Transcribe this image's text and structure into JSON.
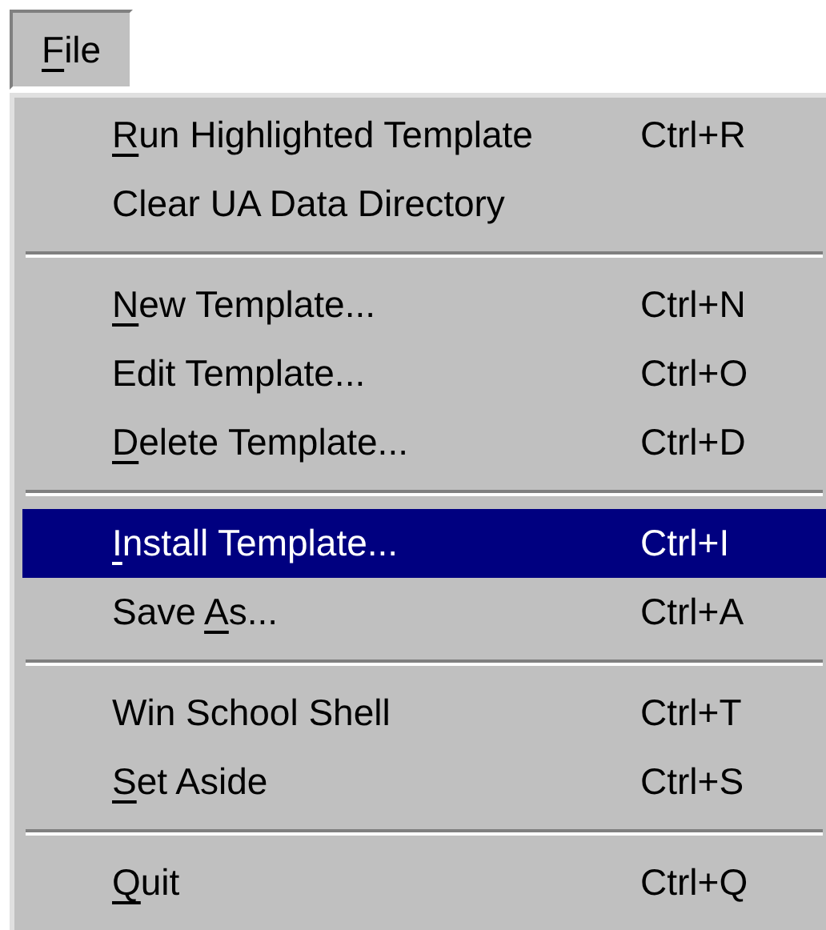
{
  "menubar": [
    {
      "access_key": "F",
      "label_end": "ile",
      "open": true
    }
  ],
  "menu": {
    "sections": [
      {
        "items": [
          {
            "access_key": "R",
            "label_end": "un Highlighted Template",
            "shortcut": "Ctrl+R",
            "selected": false
          },
          {
            "label_start": "Clear UA Data Directory",
            "selected": false
          }
        ]
      },
      {
        "items": [
          {
            "access_key": "N",
            "label_end": "ew Template...",
            "shortcut": "Ctrl+N",
            "selected": false
          },
          {
            "label_start": "Edit Template...",
            "shortcut": "Ctrl+O",
            "selected": false
          },
          {
            "access_key": "D",
            "label_end": "elete Template...",
            "shortcut": "Ctrl+D",
            "selected": false
          }
        ]
      },
      {
        "items": [
          {
            "access_key": "I",
            "label_end": "nstall Template...",
            "shortcut": "Ctrl+I",
            "selected": true
          },
          {
            "label_start": "Save ",
            "access_key": "A",
            "label_end": "s...",
            "shortcut": "Ctrl+A",
            "selected": false
          }
        ]
      },
      {
        "items": [
          {
            "label_start": "Win School Shell",
            "shortcut": "Ctrl+T",
            "selected": false
          },
          {
            "access_key": "S",
            "label_end": "et Aside",
            "shortcut": "Ctrl+S",
            "selected": false
          }
        ]
      },
      {
        "items": [
          {
            "access_key": "Q",
            "label_end": "uit",
            "shortcut": "Ctrl+Q",
            "selected": false
          }
        ]
      }
    ]
  }
}
